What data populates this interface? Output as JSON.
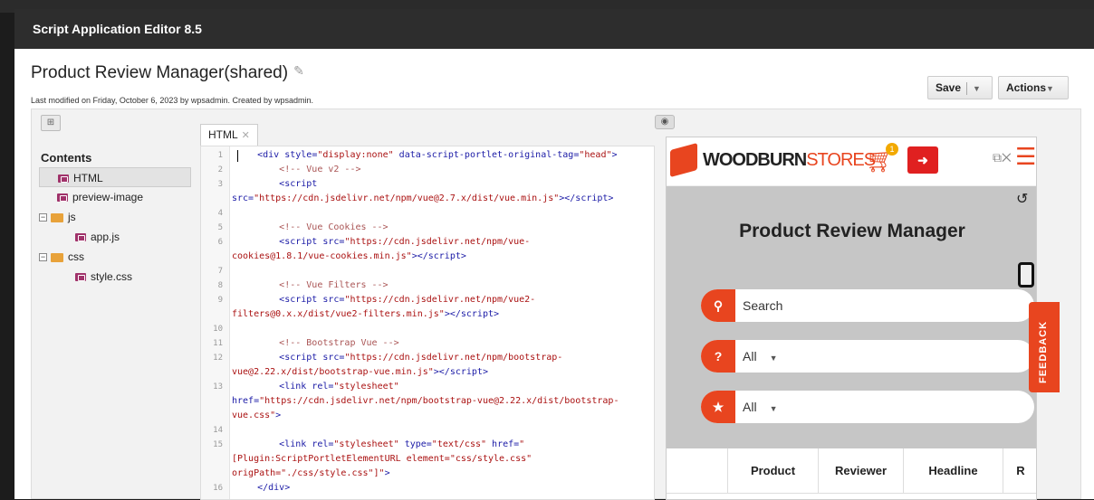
{
  "window": {
    "title": "Script Application Editor 8.5"
  },
  "header": {
    "page_title": "Product Review Manager(shared)",
    "modified": "Last modified on Friday, October 6, 2023 by wpsadmin. Created by wpsadmin.",
    "save_label": "Save",
    "actions_label": "Actions"
  },
  "tree": {
    "title": "Contents",
    "items": [
      {
        "label": "HTML"
      },
      {
        "label": "preview-image"
      },
      {
        "label": "js"
      },
      {
        "label": "app.js"
      },
      {
        "label": "css"
      },
      {
        "label": "style.css"
      }
    ]
  },
  "editor": {
    "tab_label": "HTML",
    "line_numbers": [
      "1",
      "2",
      "3",
      "4",
      "5",
      "6",
      "7",
      "8",
      "9",
      "10",
      "11",
      "12",
      "13",
      "14",
      "15",
      "16"
    ]
  },
  "preview": {
    "brand_bold": "WOODBURN",
    "brand_light": "STORES",
    "cart_count": "1",
    "app_title": "Product Review Manager",
    "search_placeholder": "Search",
    "filter1_value": "All",
    "filter2_value": "All",
    "columns": [
      "Product",
      "Reviewer",
      "Headline",
      "R"
    ]
  },
  "feedback_label": "FEEDBACK",
  "icons": [
    "pencil-icon",
    "tree-icon",
    "eye-icon",
    "cart-icon",
    "logout-icon",
    "menu-icon",
    "refresh-icon",
    "phone-icon",
    "search-icon",
    "question-icon",
    "star-icon"
  ],
  "colors": {
    "brand": "#e8451f",
    "titlebar": "#2d2d2d"
  }
}
